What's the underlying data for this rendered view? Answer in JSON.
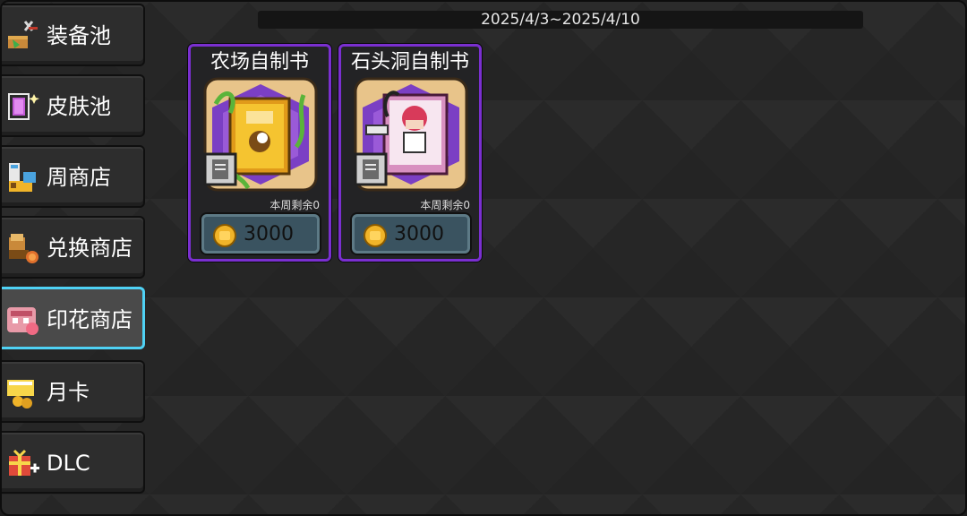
{
  "header": {
    "date_range": "2025/4/3~2025/4/10"
  },
  "sidebar": {
    "items": [
      {
        "label": "装备池",
        "icon": "equipment-pool-icon"
      },
      {
        "label": "皮肤池",
        "icon": "skin-pool-icon"
      },
      {
        "label": "周商店",
        "icon": "weekly-shop-icon"
      },
      {
        "label": "兑换商店",
        "icon": "exchange-shop-icon"
      },
      {
        "label": "印花商店",
        "icon": "stamp-shop-icon",
        "active": true
      },
      {
        "label": "月卡",
        "icon": "monthly-card-icon"
      },
      {
        "label": "DLC",
        "icon": "dlc-gift-icon"
      }
    ]
  },
  "shop": {
    "items": [
      {
        "title": "农场自制书",
        "remaining": "本周剩余0",
        "price": "3000",
        "art": "farm-book-icon"
      },
      {
        "title": "石头洞自制书",
        "remaining": "本周剩余0",
        "price": "3000",
        "art": "stone-cave-book-icon"
      }
    ]
  },
  "colors": {
    "active_tab_border": "#4fd2f5",
    "card_border": "#7a2fd0",
    "price_button": "#3a5360",
    "coin": "#f0b429"
  }
}
